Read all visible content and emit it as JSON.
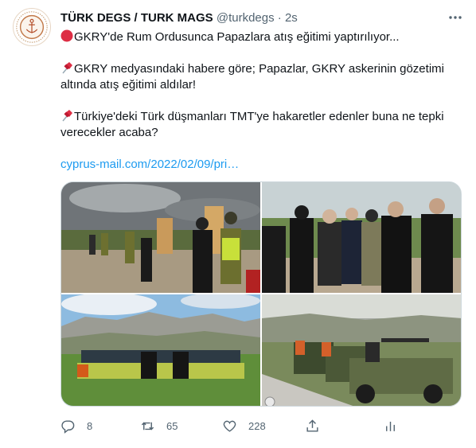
{
  "author": {
    "display_name": "TÜRK DEGS / TURK MAGS",
    "handle": "@turkdegs",
    "separator": "·",
    "timestamp": "2s",
    "avatar_icon": "anchor-emblem-icon"
  },
  "tweet": {
    "line1": "GKRY'de Rum Ordusunca Papazlara atış eğitimi yaptırılıyor...",
    "line2": "GKRY medyasındaki habere göre; Papazlar, GKRY askerinin gözetimi altında atış eğitimi aldılar!",
    "line3": "Türkiye'deki Türk düşmanları  TMT'ye hakaretler edenler buna ne tepki verecekler acaba?",
    "link": "cyprus-mail.com/2022/02/09/pri…",
    "emoji_red_circle": "red-circle-icon",
    "emoji_pushpin": "pushpin-icon"
  },
  "media": {
    "count": 4,
    "images": [
      "priests-shooting-range-photo",
      "priests-with-soldiers-photo",
      "group-photo-hills",
      "military-jeeps-firing-photo"
    ]
  },
  "actions": {
    "reply_count": "8",
    "retweet_count": "65",
    "like_count": "228"
  },
  "colors": {
    "link": "#1d9bf0",
    "muted": "#536471",
    "border": "#cfd9de"
  }
}
